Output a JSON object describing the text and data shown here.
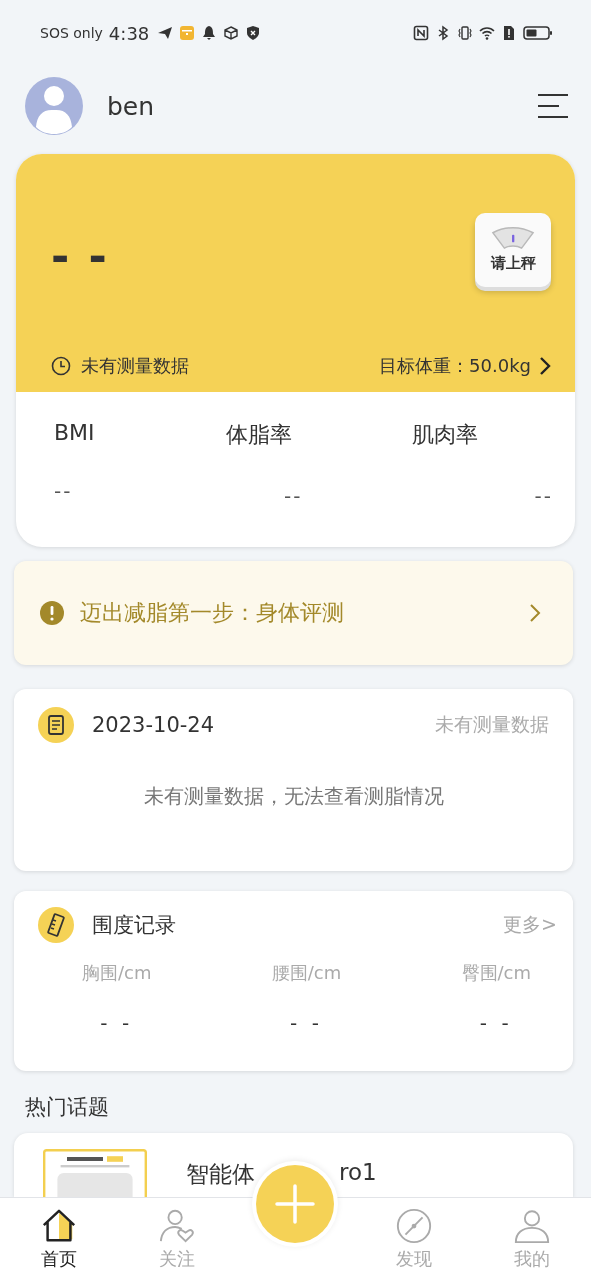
{
  "status_bar": {
    "carrier": "SOS only",
    "time": "4:38"
  },
  "header": {
    "user_name": "ben"
  },
  "weight_card": {
    "weight": "- -",
    "scale_button": "请上秤",
    "last_measure": "未有测量数据",
    "target": "目标体重：50.0kg",
    "metrics": [
      {
        "label": "BMI",
        "value": "--"
      },
      {
        "label": "体脂率",
        "value": "--"
      },
      {
        "label": "肌肉率",
        "value": "--"
      }
    ]
  },
  "banner": {
    "text": "迈出减脂第一步：身体评测"
  },
  "daily_record": {
    "date": "2023-10-24",
    "status": "未有测量数据",
    "message": "未有测量数据，无法查看测脂情况"
  },
  "girth_record": {
    "title": "围度记录",
    "more": "更多>",
    "items": [
      {
        "label": "胸围/cm",
        "value": "- -"
      },
      {
        "label": "腰围/cm",
        "value": "- -"
      },
      {
        "label": "臀围/cm",
        "value": "- -"
      }
    ]
  },
  "hot_topics": {
    "heading": "热门话题",
    "items": [
      {
        "title_start": "智能体",
        "title_end": "ro1"
      }
    ]
  },
  "tab_bar": {
    "tabs": [
      {
        "label": "首页",
        "selected": true
      },
      {
        "label": "关注",
        "selected": false
      },
      {
        "label": "发现",
        "selected": false
      },
      {
        "label": "我的",
        "selected": false
      }
    ]
  }
}
